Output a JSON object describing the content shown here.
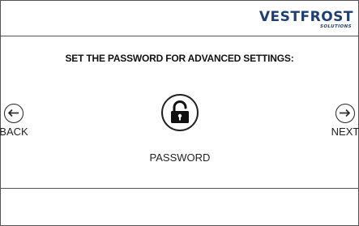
{
  "header": {
    "logo_main": "VESTFROST",
    "logo_sub": "SOLUTIONS"
  },
  "main": {
    "title": "SET THE PASSWORD FOR ADVANCED SETTINGS:",
    "back_label": "BACK",
    "next_label": "NEXT",
    "password_label": "PASSWORD"
  },
  "icons": {
    "back": "arrow-left-icon",
    "next": "arrow-right-icon",
    "password": "unlocked-padlock-icon"
  },
  "colors": {
    "brand": "#1f3f73",
    "text": "#111111",
    "border": "#555555"
  }
}
